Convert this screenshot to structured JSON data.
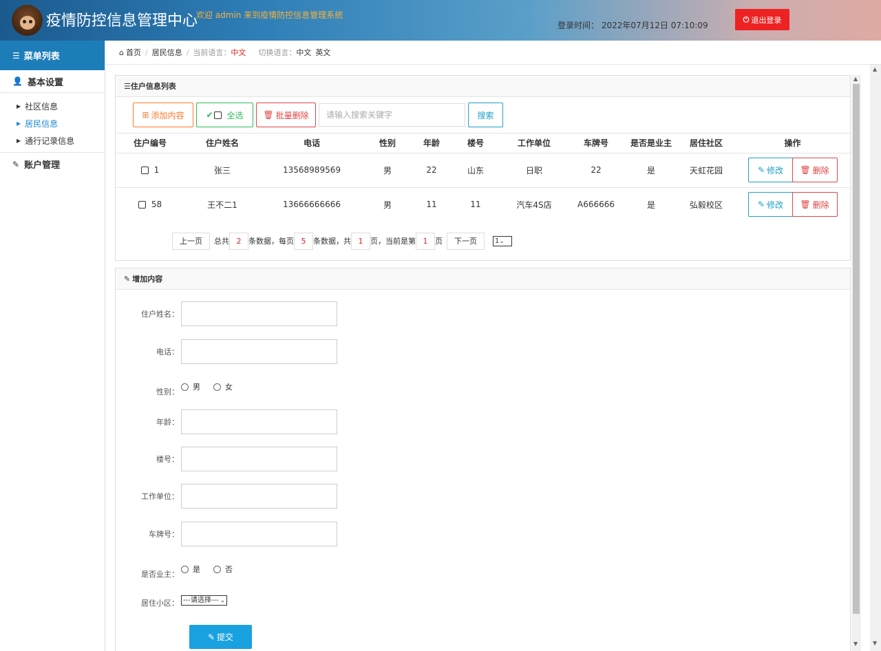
{
  "header": {
    "title": "疫情防控信息管理中心",
    "welcome": "欢迎 admin 来到疫情防控信息管理系统",
    "login_time": "登录时间：  2022年07月12日 07:10:09",
    "logout": "退出登录",
    "colors": {
      "logout": "#ee2222",
      "welcome": "#f7b23b",
      "accent": "#1d7db8"
    }
  },
  "sidebar": {
    "menu_title": "菜单列表",
    "groups": [
      {
        "label": "基本设置",
        "items": [
          {
            "label": "社区信息",
            "active": false
          },
          {
            "label": "居民信息",
            "active": true
          },
          {
            "label": "通行记录信息",
            "active": false
          }
        ]
      },
      {
        "label": "账户管理"
      }
    ]
  },
  "breadcrumb": {
    "home": "首页",
    "current": "居民信息",
    "lang_label": "当前语言：",
    "lang_current": "中文",
    "switch_label": "切换语言：",
    "switch_zh": "中文",
    "switch_en": "英文"
  },
  "list_panel": {
    "title": "住户信息列表",
    "add_btn": "添加内容",
    "select_all": "全选",
    "batch_delete": "批量删除",
    "search_placeholder": "请输入搜索关键字",
    "search_btn": "搜索",
    "columns": [
      "住户编号",
      "住户姓名",
      "电话",
      "性别",
      "年龄",
      "楼号",
      "工作单位",
      "车牌号",
      "是否是业主",
      "居住社区",
      "操作"
    ],
    "rows": [
      {
        "id": "1",
        "name": "张三",
        "phone": "13568989569",
        "gender": "男",
        "age": "22",
        "building": "山东",
        "work": "日职",
        "plate": "22",
        "owner": "是",
        "community": "天虹花园"
      },
      {
        "id": "58",
        "name": "王不二1",
        "phone": "13666666666",
        "gender": "男",
        "age": "11",
        "building": "11",
        "work": "汽车4S店",
        "plate": "A666666",
        "owner": "是",
        "community": "弘毅校区"
      }
    ],
    "edit_btn": "修改",
    "delete_btn": "删除",
    "pager": {
      "prev": "上一页",
      "total_pre": "总共",
      "total": "2",
      "total_post": "条数据，每页",
      "per_page": "5",
      "per_page_post": "条数据，共",
      "pages": "1",
      "pages_post": "页，当前是第",
      "current": "1",
      "current_post": "页",
      "next": "下一页",
      "select": "1"
    }
  },
  "form_panel": {
    "title": "增加内容",
    "fields": {
      "name": "住户姓名：",
      "phone": "电话：",
      "gender": "性别：",
      "age": "年龄：",
      "building": "楼号：",
      "work": "工作单位：",
      "plate": "车牌号：",
      "owner": "是否业主：",
      "community": "居住小区："
    },
    "gender_options": [
      "男",
      "女"
    ],
    "owner_options": [
      "是",
      "否"
    ],
    "community_select": "---请选择---",
    "submit": "提交"
  }
}
